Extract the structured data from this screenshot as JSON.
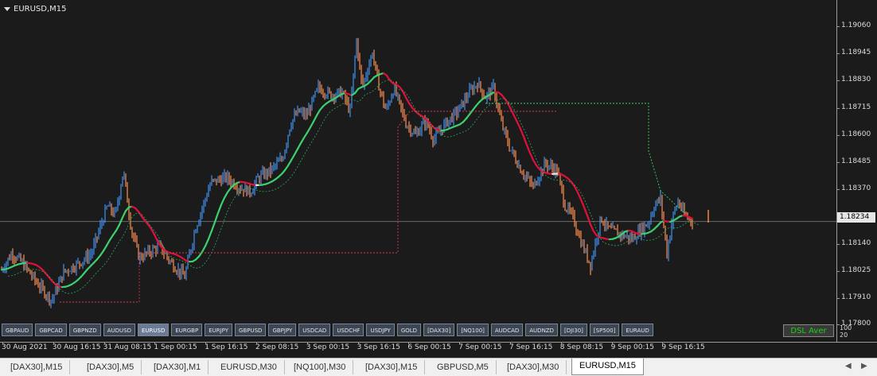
{
  "chart": {
    "symbol_title": "EURUSD,M15",
    "current_price": "1.18234",
    "y_ticks": [
      {
        "label": "1.19060",
        "value": 1.1906
      },
      {
        "label": "1.18945",
        "value": 1.18945
      },
      {
        "label": "1.18830",
        "value": 1.1883
      },
      {
        "label": "1.18715",
        "value": 1.18715
      },
      {
        "label": "1.18600",
        "value": 1.186
      },
      {
        "label": "1.18485",
        "value": 1.18485
      },
      {
        "label": "1.18370",
        "value": 1.1837
      },
      {
        "label": "1.18140",
        "value": 1.1814
      },
      {
        "label": "1.18025",
        "value": 1.18025
      },
      {
        "label": "1.17910",
        "value": 1.1791
      },
      {
        "label": "1.17800",
        "value": 1.178
      }
    ],
    "x_ticks": [
      "30 Aug 2021",
      "30 Aug 16:15",
      "31 Aug 08:15",
      "1 Sep 00:15",
      "1 Sep 16:15",
      "2 Sep 08:15",
      "3 Sep 00:15",
      "3 Sep 16:15",
      "6 Sep 00:15",
      "7 Sep 00:15",
      "7 Sep 16:15",
      "8 Sep 08:15",
      "9 Sep 00:15",
      "9 Sep 16:15"
    ],
    "indicator_label": "DSL Aver",
    "subwindow_levels": [
      "100",
      "20"
    ],
    "colors": {
      "bull": "#3d8be6",
      "bear": "#f0854a",
      "ma_up": "#3cd06e",
      "ma_down": "#e0103c",
      "ma_flat": "#e8e8e8"
    }
  },
  "symbol_buttons": [
    "GBPAUD",
    "GBPCAD",
    "GBPNZD",
    "AUDUSD",
    "EURUSD",
    "EURGBP",
    "EURJPY",
    "GBPUSD",
    "GBPJPY",
    "USDCAD",
    "USDCHF",
    "USDJPY",
    "GOLD",
    "[DAX30]",
    "[NQ100]",
    "AUDCAD",
    "AUDNZD",
    "[DJI30]",
    "[SP500]",
    "EURAUD"
  ],
  "active_symbol": "EURUSD",
  "tabs": [
    "[DAX30],M15",
    "[DAX30],M5",
    "[DAX30],M1",
    "EURUSD,M30",
    "[NQ100],M30",
    "[DAX30],M15",
    "GBPUSD,M5",
    "[DAX30],M30",
    "EURUSD,M15"
  ],
  "active_tab_index": 8
}
